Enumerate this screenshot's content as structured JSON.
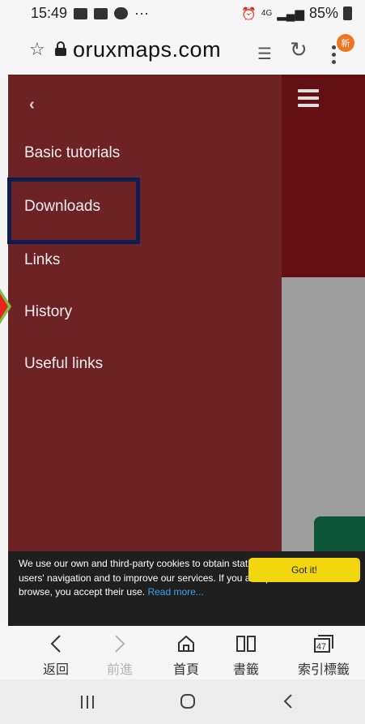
{
  "status_bar": {
    "time": "15:49",
    "more": "···",
    "network": "4G",
    "battery": "85%"
  },
  "url_bar": {
    "url": "oruxmaps.com",
    "badge": "新"
  },
  "drawer": {
    "back_glyph": "‹",
    "items": [
      "Basic tutorials",
      "Downloads",
      "Links",
      "History",
      "Useful links"
    ]
  },
  "cookie_banner": {
    "text": "We use our own and third-party cookies to obtain statistical data about our users' navigation and to improve our services. If you accept or continue to browse, you accept their use.",
    "read_more": "Read more...",
    "button": "Got it!"
  },
  "toolbar": {
    "back": "返回",
    "forward": "前進",
    "home": "首頁",
    "bookmarks": "書籤",
    "tabs": "索引標籤",
    "tab_count": "47"
  },
  "colors": {
    "drawer": "#6d2326",
    "header": "#621014",
    "highlight_box": "#0c1d52",
    "cookie_button": "#f2d60e",
    "badge": "#f0751f"
  }
}
